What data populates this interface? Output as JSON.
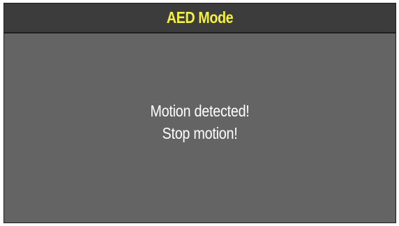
{
  "header": {
    "title": "AED Mode"
  },
  "message": {
    "line1": "Motion detected!",
    "line2": "Stop motion!"
  },
  "colors": {
    "title_text": "#f5f03c",
    "title_bar": "#3c3c3c",
    "screen_background": "#646464",
    "message_text": "#ffffff"
  }
}
